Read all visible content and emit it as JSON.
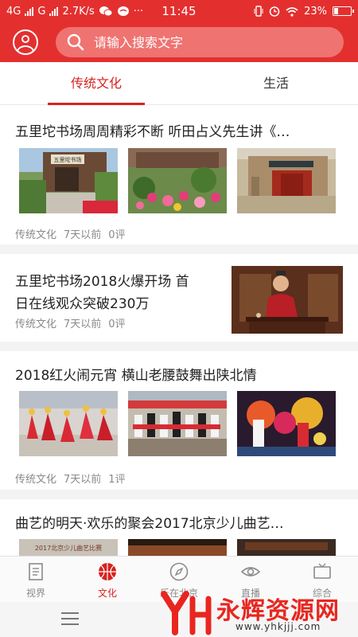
{
  "status_bar": {
    "network": "4G",
    "carrier": "G",
    "speed": "2.7K/s",
    "time": "11:45",
    "battery": "23%"
  },
  "header": {
    "search_placeholder": "请输入搜索文字"
  },
  "tabs": [
    {
      "label": "传统文化",
      "active": true
    },
    {
      "label": "生活",
      "active": false
    }
  ],
  "articles": [
    {
      "title": "五里坨书场周周精彩不断 听田占义先生讲《…",
      "category": "传统文化",
      "time": "7天以前",
      "comments": "0评",
      "thumb_sign": "五里坨书场"
    },
    {
      "title_line1": "五里坨书场2018火爆开场 首",
      "title_line2": "日在线观众突破230万",
      "category": "传统文化",
      "time": "7天以前",
      "comments": "0评"
    },
    {
      "title": "2018红火闹元宵 横山老腰鼓舞出陕北情",
      "category": "传统文化",
      "time": "7天以前",
      "comments": "1评"
    },
    {
      "title": "曲艺的明天·欢乐的聚会2017北京少儿曲艺…",
      "thumb_banner": "2017北京少儿曲艺比赛"
    }
  ],
  "bottom_nav": [
    {
      "label": "视界",
      "icon": "document-icon",
      "active": false
    },
    {
      "label": "文化",
      "icon": "basketball-icon",
      "active": true
    },
    {
      "label": "乐在北京",
      "icon": "compass-icon",
      "active": false
    },
    {
      "label": "直播",
      "icon": "eye-icon",
      "active": false
    },
    {
      "label": "综合",
      "icon": "tv-icon",
      "active": false
    }
  ],
  "watermark": {
    "brand": "永辉资源网",
    "url": "www.yhkjjj.com"
  },
  "colors": {
    "brand_red": "#e3302f",
    "active_red": "#d6231f",
    "meta_gray": "#8a8a8a"
  }
}
